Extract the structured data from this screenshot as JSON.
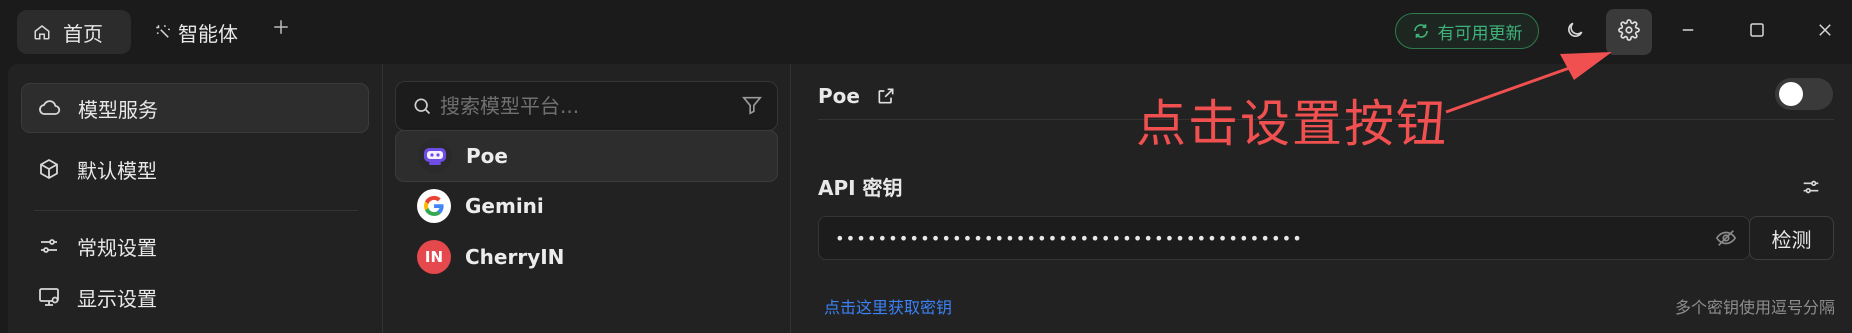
{
  "titlebar": {
    "tabs": [
      {
        "label": "首页",
        "icon": "home-icon"
      },
      {
        "label": "智能体",
        "icon": "sparkle-icon"
      }
    ],
    "add_tab_icon": "plus-icon",
    "update_label": "有可用更新",
    "theme_icon": "moon-icon",
    "settings_icon": "gear-icon",
    "window_controls": [
      "minimize-icon",
      "maximize-icon",
      "close-icon"
    ]
  },
  "sidebar": {
    "items": [
      {
        "label": "模型服务",
        "icon": "cloud-icon",
        "active": true
      },
      {
        "label": "默认模型",
        "icon": "cube-icon"
      },
      {
        "label": "常规设置",
        "icon": "sliders-icon"
      },
      {
        "label": "显示设置",
        "icon": "monitor-icon"
      }
    ]
  },
  "providers": {
    "search_placeholder": "搜索模型平台...",
    "items": [
      {
        "name": "Poe",
        "active": true
      },
      {
        "name": "Gemini"
      },
      {
        "name": "CherryIN",
        "logo_text": "IN"
      }
    ]
  },
  "detail": {
    "title": "Poe",
    "enabled": false,
    "api_key_label": "API 密钥",
    "api_key_value": "••••••••••••••••••••••••••••••••••••••••••••",
    "check_label": "检测",
    "get_key_link": "点击这里获取密钥",
    "separator_hint": "多个密钥使用逗号分隔"
  },
  "annotation": {
    "text": "点击设置按钮",
    "color": "#f05050"
  },
  "colors": {
    "accent_green": "#3fb27a",
    "link_blue": "#3b82f6",
    "cherry_red": "#e5484d"
  }
}
